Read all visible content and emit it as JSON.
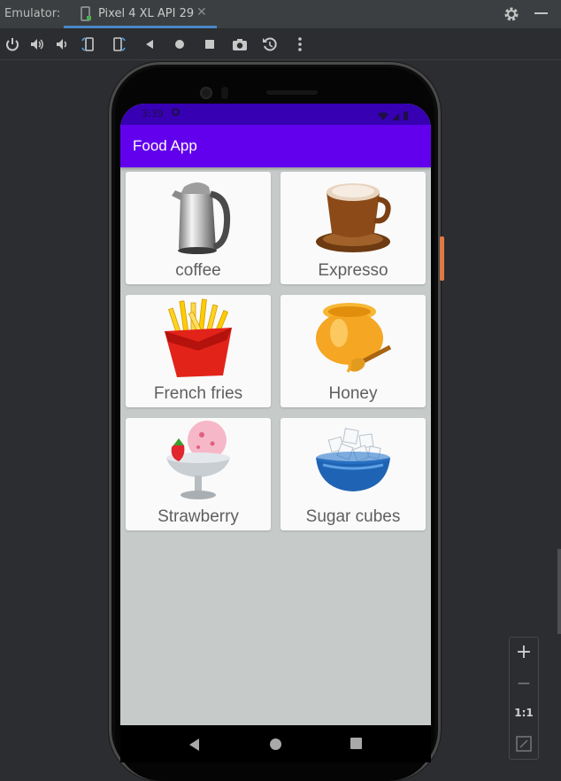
{
  "ide": {
    "emulator_label": "Emulator:",
    "device_tab": "Pixel 4 XL API 29",
    "tab_close": "✕"
  },
  "toolbar": {
    "icons": [
      "power-icon",
      "volume-up-icon",
      "volume-down-icon",
      "rotate-left-icon",
      "rotate-right-icon",
      "back-icon",
      "home-icon",
      "overview-icon",
      "camera-icon",
      "replay-icon",
      "more-icon"
    ]
  },
  "device": {
    "status_time": "3:39",
    "app_title": "Food App",
    "colors": {
      "status_bar": "#3700b3",
      "app_bar": "#6200ee",
      "background": "#c6cbca"
    },
    "items": [
      {
        "label": "coffee",
        "icon": "kettle-image"
      },
      {
        "label": "Expresso",
        "icon": "coffee-cup-image"
      },
      {
        "label": "French fries",
        "icon": "french-fries-image"
      },
      {
        "label": "Honey",
        "icon": "honey-pot-image"
      },
      {
        "label": "Strawberry",
        "icon": "ice-cream-image"
      },
      {
        "label": "Sugar cubes",
        "icon": "sugar-bowl-image"
      }
    ]
  },
  "zoom": {
    "zoom_in": "+",
    "zoom_out": "−",
    "one_to_one": "1:1"
  }
}
